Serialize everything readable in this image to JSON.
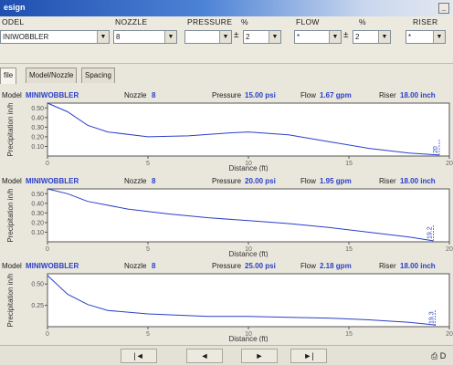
{
  "window": {
    "title": "esign",
    "help_label": "_"
  },
  "params": {
    "model_label": "ODEL",
    "model_value": "INIWOBBLER",
    "nozzle_label": "NOZZLE",
    "nozzle_value": "8",
    "pressure_label": "PRESSURE",
    "pressure_pct_label": "%",
    "pressure_value": "",
    "pressure_tol": "2",
    "flow_label": "FLOW",
    "flow_pct_label": "%",
    "flow_value": "*",
    "flow_tol": "2",
    "riser_label": "RISER",
    "riser_value": "*",
    "plusminus": "±"
  },
  "tabs": [
    {
      "label": "file"
    },
    {
      "label": "Model/Nozzle"
    },
    {
      "label": "Spacing"
    }
  ],
  "panels": [
    {
      "model_label": "Model",
      "model": "MINIWOBBLER",
      "nozzle_label": "Nozzle",
      "nozzle": "8",
      "pressure_label": "Pressure",
      "pressure": "15.00 psi",
      "flow_label": "Flow",
      "flow": "1.67 gpm",
      "riser_label": "Riser",
      "riser": "18.00 inch"
    },
    {
      "model_label": "Model",
      "model": "MINIWOBBLER",
      "nozzle_label": "Nozzle",
      "nozzle": "8",
      "pressure_label": "Pressure",
      "pressure": "20.00 psi",
      "flow_label": "Flow",
      "flow": "1.95 gpm",
      "riser_label": "Riser",
      "riser": "18.00 inch"
    },
    {
      "model_label": "Model",
      "model": "MINIWOBBLER",
      "nozzle_label": "Nozzle",
      "nozzle": "8",
      "pressure_label": "Pressure",
      "pressure": "25.00 psi",
      "flow_label": "Flow",
      "flow": "2.18 gpm",
      "riser_label": "Riser",
      "riser": "18.00 inch"
    }
  ],
  "chart_data": [
    {
      "type": "line",
      "xlabel": "Distance (ft)",
      "ylabel": "Precipitation in/h",
      "xlim": [
        0,
        20
      ],
      "ylim": [
        0,
        0.55
      ],
      "xticks": [
        "0",
        "5",
        "10",
        "15",
        "20"
      ],
      "yticks": [
        "0.50",
        "0.40",
        "0.30",
        "0.20",
        "0.10"
      ],
      "end_label": "20",
      "series": [
        {
          "x": [
            0,
            1,
            2,
            3,
            5,
            7,
            9,
            10,
            12,
            14,
            16,
            18,
            19.5
          ],
          "y": [
            0.55,
            0.46,
            0.32,
            0.25,
            0.2,
            0.21,
            0.24,
            0.25,
            0.22,
            0.15,
            0.08,
            0.03,
            0.01
          ]
        }
      ],
      "color": "#2a3fc8",
      "grid": false
    },
    {
      "type": "line",
      "xlabel": "Distance (ft)",
      "ylabel": "Precipitation in/h",
      "xlim": [
        0,
        20
      ],
      "ylim": [
        0,
        0.55
      ],
      "xticks": [
        "0",
        "5",
        "10",
        "15",
        "20"
      ],
      "yticks": [
        "0.50",
        "0.40",
        "0.30",
        "0.20",
        "0.10"
      ],
      "end_label": "19.2",
      "series": [
        {
          "x": [
            0,
            1,
            2,
            4,
            6,
            8,
            10,
            12,
            14,
            16,
            18,
            19.2
          ],
          "y": [
            0.55,
            0.5,
            0.42,
            0.34,
            0.29,
            0.25,
            0.22,
            0.19,
            0.15,
            0.1,
            0.05,
            0.01
          ]
        }
      ],
      "color": "#2a3fc8",
      "grid": false
    },
    {
      "type": "line",
      "xlabel": "Distance (ft)",
      "ylabel": "Precipitation in/h",
      "xlim": [
        0,
        20
      ],
      "ylim": [
        0,
        0.62
      ],
      "xticks": [
        "0",
        "5",
        "10",
        "15",
        "20"
      ],
      "yticks": [
        "0.50",
        "0.25"
      ],
      "end_label": "19.3",
      "series": [
        {
          "x": [
            0,
            1,
            2,
            3,
            5,
            8,
            10,
            12,
            14,
            16,
            18,
            19.3
          ],
          "y": [
            0.6,
            0.38,
            0.26,
            0.19,
            0.15,
            0.12,
            0.12,
            0.11,
            0.1,
            0.08,
            0.05,
            0.02
          ]
        }
      ],
      "color": "#2a3fc8",
      "grid": false
    }
  ],
  "nav": {
    "first": "|◄",
    "prev": "◄",
    "next": "►",
    "last": "►|",
    "right_label": "D"
  }
}
